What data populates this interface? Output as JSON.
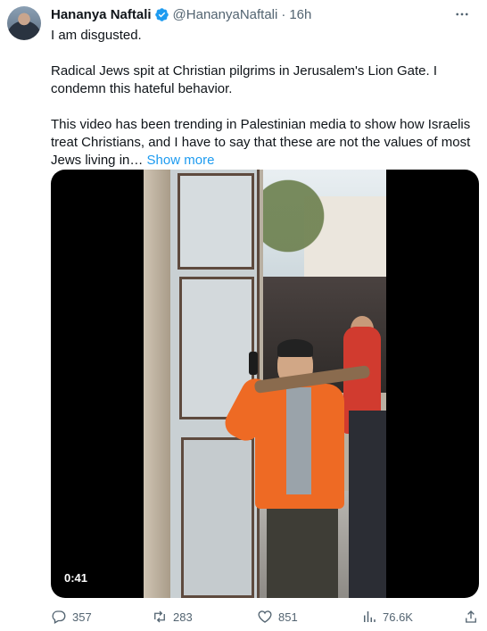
{
  "author": {
    "name": "Hananya Naftali",
    "handle": "@HananyaNaftali",
    "separator": "·",
    "time": "16h",
    "verified": true
  },
  "tweet": {
    "paragraphs": [
      "I am disgusted.",
      "Radical Jews spit at Christian pilgrims in Jerusalem's Lion Gate. I condemn this hateful behavior.",
      "This video has been trending in Palestinian media to show how Israelis treat Christians, and I have to say that these are not the values of most Jews living in…"
    ],
    "show_more": "Show more"
  },
  "media": {
    "type": "video",
    "duration": "0:41"
  },
  "actions": {
    "replies": "357",
    "retweets": "283",
    "likes": "851",
    "views": "76.6K"
  },
  "colors": {
    "accent": "#1d9bf0",
    "text": "#0f1419",
    "secondary": "#536471"
  }
}
